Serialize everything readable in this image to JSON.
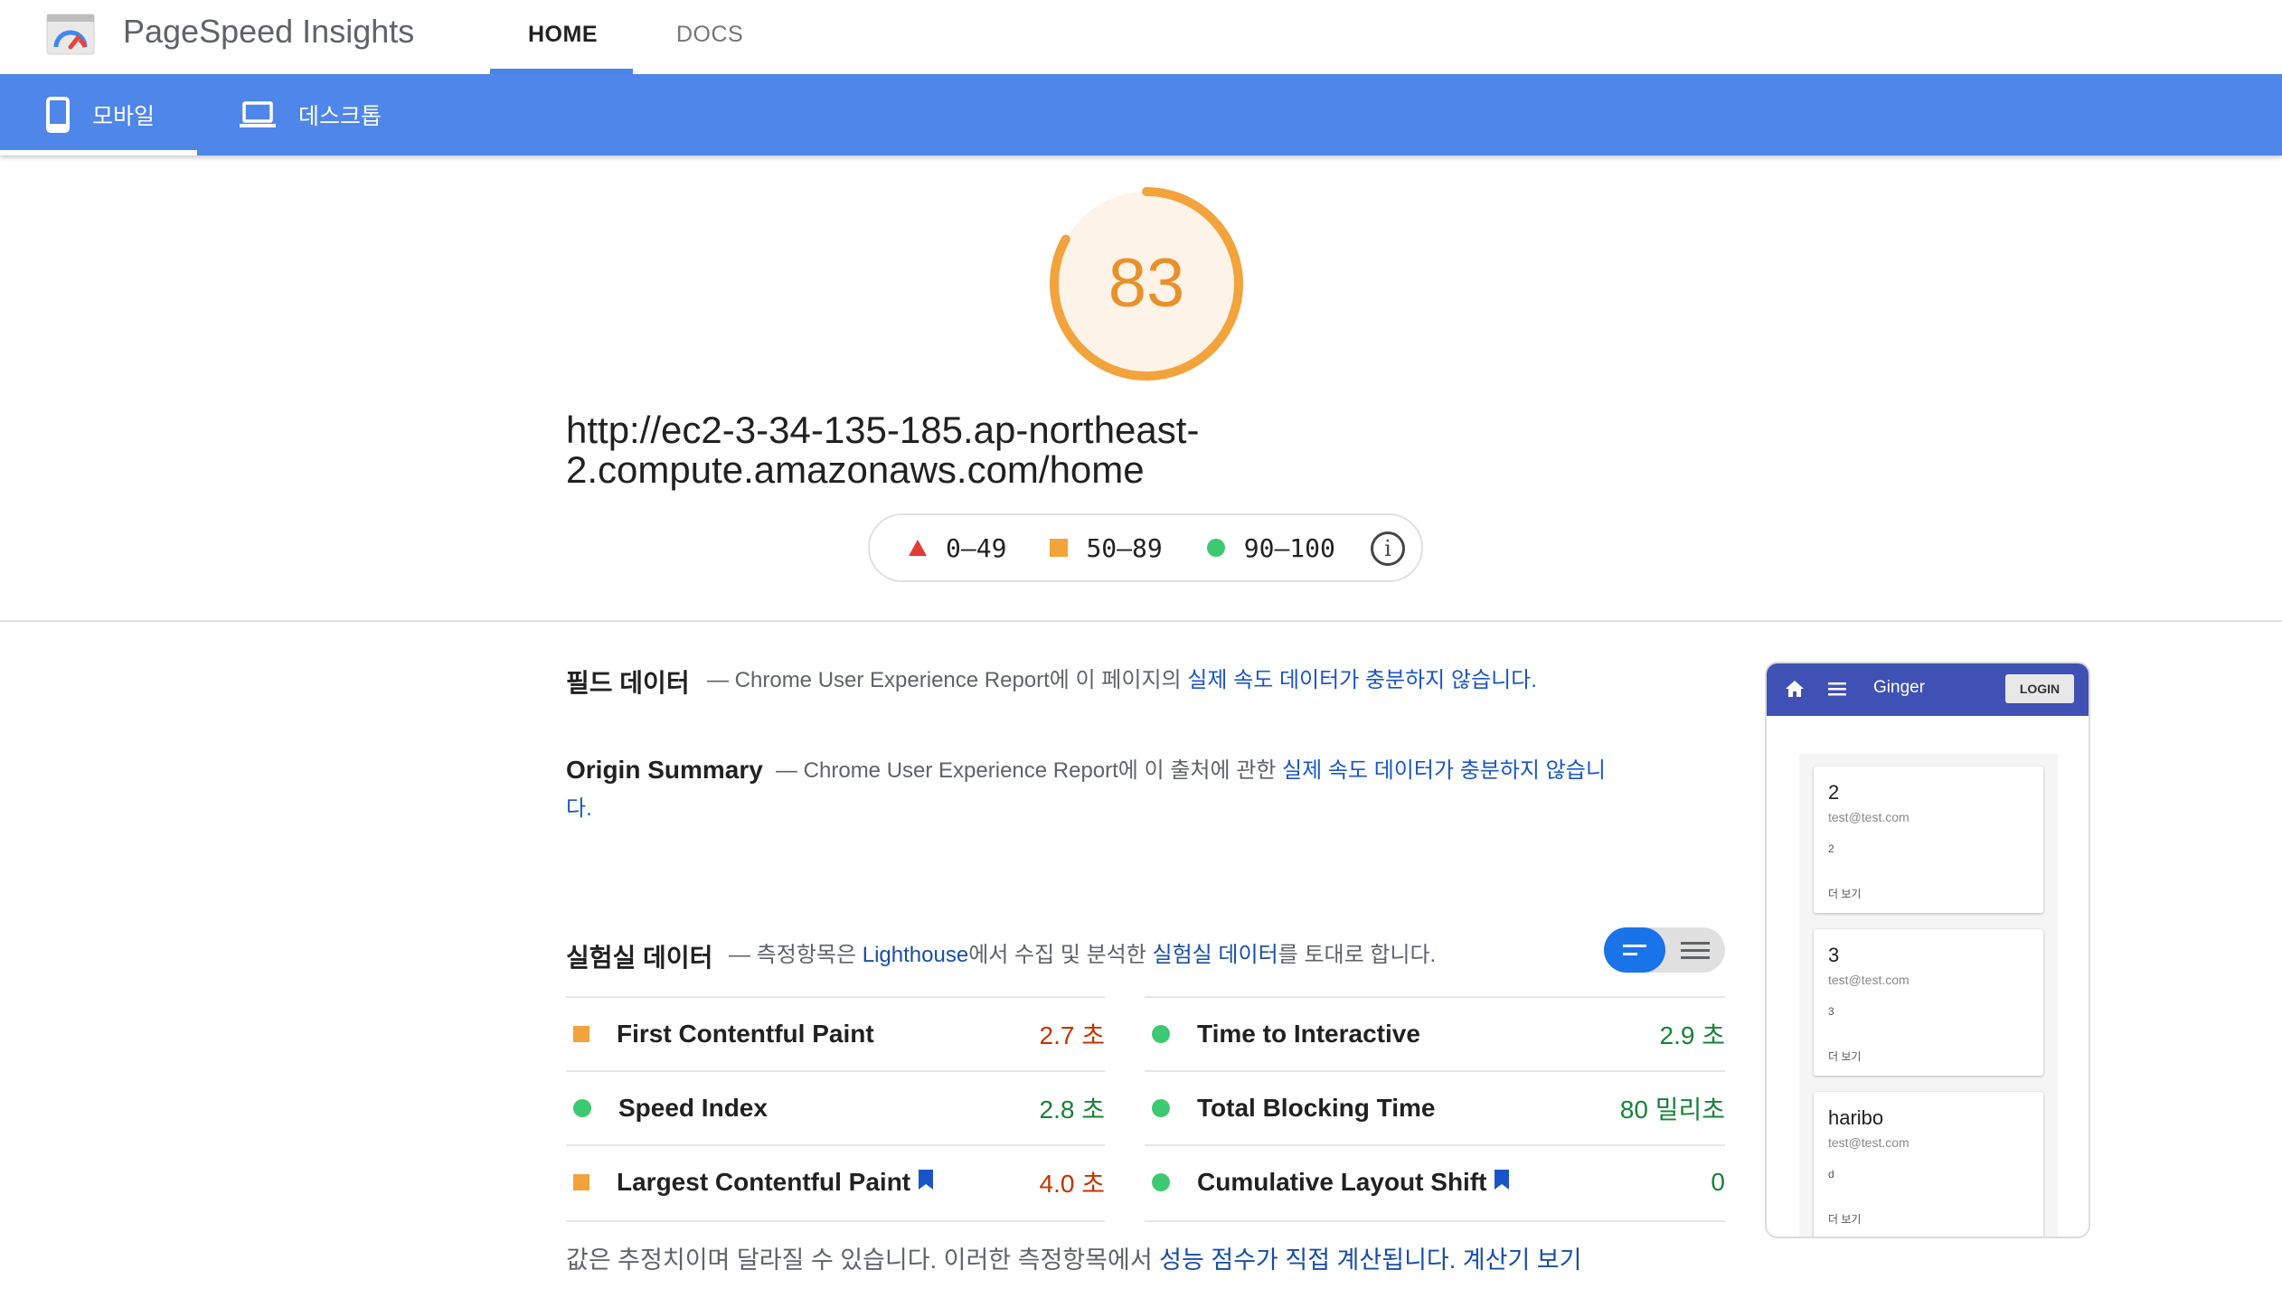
{
  "header": {
    "app_title": "PageSpeed Insights",
    "nav": [
      {
        "label": "HOME",
        "active": true
      },
      {
        "label": "DOCS",
        "active": false
      }
    ]
  },
  "device_tabs": [
    {
      "label": "모바일",
      "icon": "mobile-phone-icon",
      "active": true
    },
    {
      "label": "데스크톱",
      "icon": "laptop-icon",
      "active": false
    }
  ],
  "colors": {
    "accent_blue": "#4e86e9",
    "score_orange": "#e8912a",
    "fail_red": "#e53935",
    "pass_green": "#3dc972",
    "link_blue": "#1a55c8"
  },
  "score": {
    "value": "83",
    "fraction": 0.83,
    "url": "http://ec2-3-34-135-185.ap-northeast-2.compute.amazonaws.com/home"
  },
  "legend": {
    "ranges": [
      "0–49",
      "50–89",
      "90–100"
    ],
    "info_icon": "info-icon"
  },
  "field_data": {
    "title": "필드 데이터",
    "desc_prefix": "— Chrome User Experience Report에 이 페이지의 ",
    "desc_link": "실제 속도 데이터가 충분하지 않습니다",
    "desc_suffix": "."
  },
  "origin_summary": {
    "title": "Origin Summary",
    "desc_prefix": "— Chrome User Experience Report에 이 출처에 관한 ",
    "desc_link": "실제 속도 데이터가 충분하지 않습니",
    "desc_link_cont": "다",
    "desc_suffix": "."
  },
  "lab_data": {
    "title": "실험실 데이터",
    "desc_prefix": "— 측정항목은 ",
    "desc_link1": "Lighthouse",
    "desc_mid": "에서 수집 및 분석한 ",
    "desc_link2": "실험실 데이터",
    "desc_suffix": "를 토대로 합니다."
  },
  "metrics_left": [
    {
      "name": "First Contentful Paint",
      "value": "2.7 초",
      "status": "average",
      "bookmark": false
    },
    {
      "name": "Speed Index",
      "value": "2.8 초",
      "status": "pass",
      "bookmark": false
    },
    {
      "name": "Largest Contentful Paint",
      "value": "4.0 초",
      "status": "average",
      "bookmark": true
    }
  ],
  "metrics_right": [
    {
      "name": "Time to Interactive",
      "value": "2.9 초",
      "status": "pass",
      "bookmark": false
    },
    {
      "name": "Total Blocking Time",
      "value": "80 밀리초",
      "status": "pass",
      "bookmark": false
    },
    {
      "name": "Cumulative Layout Shift",
      "value": "0",
      "status": "pass",
      "bookmark": true
    }
  ],
  "footnote": {
    "prefix": "값은 추정치이며 달라질 수 있습니다. 이러한 측정항목에서 ",
    "link1": "성능 점수가 직접 계산됩니다",
    "mid": ". ",
    "link2": "계산기 보기"
  },
  "thumbnail": {
    "app_name": "Ginger",
    "login_label": "LOGIN",
    "cards": [
      {
        "name": "2",
        "email": "test@test.com",
        "body": "2",
        "more": "더 보기"
      },
      {
        "name": "3",
        "email": "test@test.com",
        "body": "3",
        "more": "더 보기"
      },
      {
        "name": "haribo",
        "email": "test@test.com",
        "body": "d",
        "more": "더 보기"
      }
    ]
  }
}
